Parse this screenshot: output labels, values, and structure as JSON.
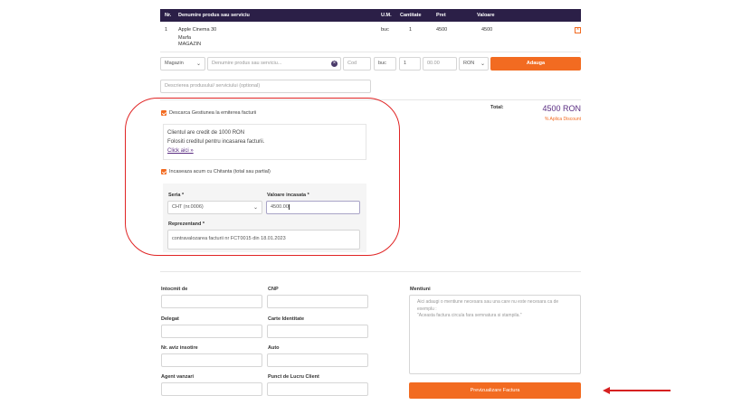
{
  "table": {
    "headers": {
      "nr": "Nr.",
      "product": "Denumire produs sau serviciu",
      "um": "U.M.",
      "qty": "Cantitate",
      "price": "Pret",
      "value": "Valoare"
    },
    "row": {
      "nr": "1",
      "name": "Apple Cinema 30",
      "line2": "Marfa",
      "line3": "MAGAZIN",
      "um": "buc",
      "qty": "1",
      "price": "4500",
      "value": "4500",
      "delete": "×"
    }
  },
  "entry": {
    "type": "Magazin",
    "name_placeholder": "Denumire produs sau serviciu...",
    "clear": "×",
    "code_placeholder": "Cod",
    "um": "buc",
    "qty": "1",
    "price_placeholder": "00.00",
    "currency": "RON",
    "add_label": "Adauga",
    "desc_placeholder": "Descrierea produsului/ serviciului (optional)"
  },
  "totals": {
    "label": "Total:",
    "value": "4500 RON",
    "discount": "% Aplica Discount"
  },
  "stock": {
    "label": "Descarca Gestiunea la emiterea facturii",
    "checked": true
  },
  "credit": {
    "line1": "Clientul are credit de 1000 RON",
    "line2": "Folositi creditul pentru incasarea facturii.",
    "link": "Click aici »"
  },
  "receipt": {
    "label": "Incaseaza acum cu Chitanta (total sau partial)",
    "checked": true
  },
  "receipt_form": {
    "series_label": "Seria *",
    "series_value": "CHT (nr.0006)",
    "amount_label": "Valoare incasata *",
    "amount_value": "4500.00",
    "rep_label": "Reprezentand *",
    "rep_value": "contravalozarea facturii nr FCT0015 din 18.01.2023"
  },
  "details": {
    "intocmit": "Intocmit de",
    "cnp": "CNP",
    "delegat": "Delegat",
    "carte": "Carte Identitate",
    "aviz": "Nr. aviz insotire",
    "auto": "Auto",
    "agent": "Agent vanzari",
    "punct": "Punct de Lucru Client",
    "mentiuni": "Mentiuni",
    "mentiuni_placeholder": "Aici adaugi o mentiune necesara sau una care nu este necesara ca de exemplu :\n\"Aceasta factura circula fara semnatura si stampila.\""
  },
  "preview_label": "Previzualizare Factura",
  "colors": {
    "header": "#2b1f47",
    "accent": "#f26b21",
    "total": "#5a2d82",
    "annotation": "#e02424"
  }
}
